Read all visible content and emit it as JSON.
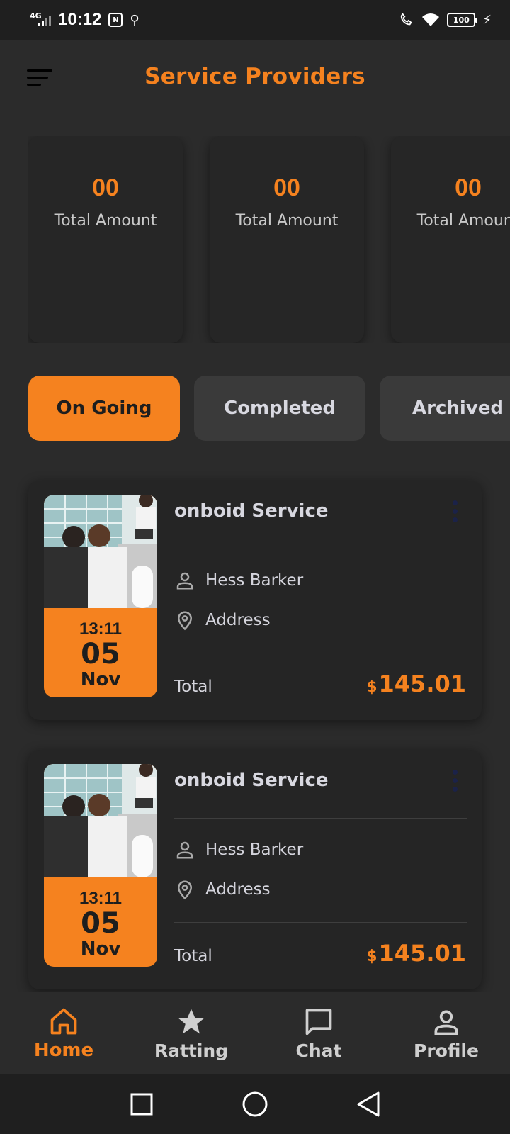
{
  "status_bar": {
    "network": "4G",
    "time": "10:12",
    "chip_label": "N",
    "battery": "100"
  },
  "header": {
    "title": "Service Providers",
    "menu_icon": "menu-icon"
  },
  "stats": [
    {
      "value": "00",
      "label": "Total Amount"
    },
    {
      "value": "00",
      "label": "Total Amount"
    },
    {
      "value": "00",
      "label": "Total Amount"
    }
  ],
  "tabs": [
    {
      "label": "On Going",
      "active": true
    },
    {
      "label": "Completed",
      "active": false
    },
    {
      "label": "Archived",
      "active": false
    }
  ],
  "bookings": [
    {
      "title": "onboid Service",
      "time": "13:11",
      "day": "05",
      "month": "Nov",
      "person": "Hess Barker",
      "address": "Address",
      "total_label": "Total",
      "currency": "$",
      "amount": "145.01"
    },
    {
      "title": "onboid Service",
      "time": "13:11",
      "day": "05",
      "month": "Nov",
      "person": "Hess Barker",
      "address": "Address",
      "total_label": "Total",
      "currency": "$",
      "amount": "145.01"
    }
  ],
  "bottom_nav": [
    {
      "label": "Home",
      "icon": "home-icon",
      "active": true
    },
    {
      "label": "Ratting",
      "icon": "star-icon",
      "active": false
    },
    {
      "label": "Chat",
      "icon": "chat-icon",
      "active": false
    },
    {
      "label": "Profile",
      "icon": "profile-icon",
      "active": false
    }
  ],
  "colors": {
    "accent": "#f5821f",
    "background": "#2b2b2b",
    "card": "#252525",
    "tab_inactive": "#3a3a3a"
  }
}
